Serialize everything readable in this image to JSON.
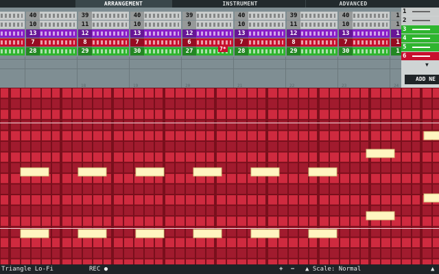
{
  "tabs": [
    {
      "label": "ARRANGEMENT",
      "active": true
    },
    {
      "label": "INSTRUMENT",
      "active": false
    },
    {
      "label": "ADVANCED",
      "active": false
    }
  ],
  "tracks": [
    {
      "name": "track-1",
      "color": "#c9cccc",
      "text": "#111111",
      "values": [
        "",
        "40",
        "39",
        "40",
        "39",
        "40",
        "39",
        "40",
        "1"
      ]
    },
    {
      "name": "track-2",
      "color": "#c9cccc",
      "text": "#111111",
      "values": [
        "",
        "10",
        "11",
        "10",
        "9",
        "10",
        "11",
        "10",
        "1"
      ]
    },
    {
      "name": "track-3",
      "color": "#8a1ec8",
      "text": "#ffffff",
      "values": [
        "",
        "13",
        "12",
        "13",
        "12",
        "13",
        "12",
        "13",
        "1"
      ]
    },
    {
      "name": "track-4",
      "color": "#c8102e",
      "text": "#ffffff",
      "values": [
        "",
        "7",
        "8",
        "7",
        "6",
        "7",
        "8",
        "7",
        "1"
      ]
    },
    {
      "name": "track-5",
      "color": "#2fb52f",
      "text": "#ffffff",
      "values": [
        "",
        "28",
        "29",
        "30",
        "27",
        "28",
        "29",
        "30",
        "1"
      ]
    }
  ],
  "overlay_label": "7*",
  "ruler": [
    "18",
    "19",
    "20",
    "21",
    "22",
    "23",
    "24"
  ],
  "side_panel": {
    "items": [
      {
        "num": "1",
        "color": "#c9cccc"
      },
      {
        "num": "2",
        "color": "#c9cccc"
      },
      {
        "num": "3",
        "color": "#2fb52f"
      },
      {
        "num": "4",
        "color": "#2fb52f"
      },
      {
        "num": "5",
        "color": "#2fb52f"
      },
      {
        "num": "6",
        "color": "#c8102e"
      }
    ],
    "add_label": "ADD NE"
  },
  "bottom_bar": {
    "instrument": "Triangle Lo-Fi",
    "rec": "REC",
    "scale": "Scale: Normal"
  },
  "colors": {
    "note": "#fff4c0",
    "row_light": "#cf2a3f",
    "row_dark": "#a11b2e"
  }
}
